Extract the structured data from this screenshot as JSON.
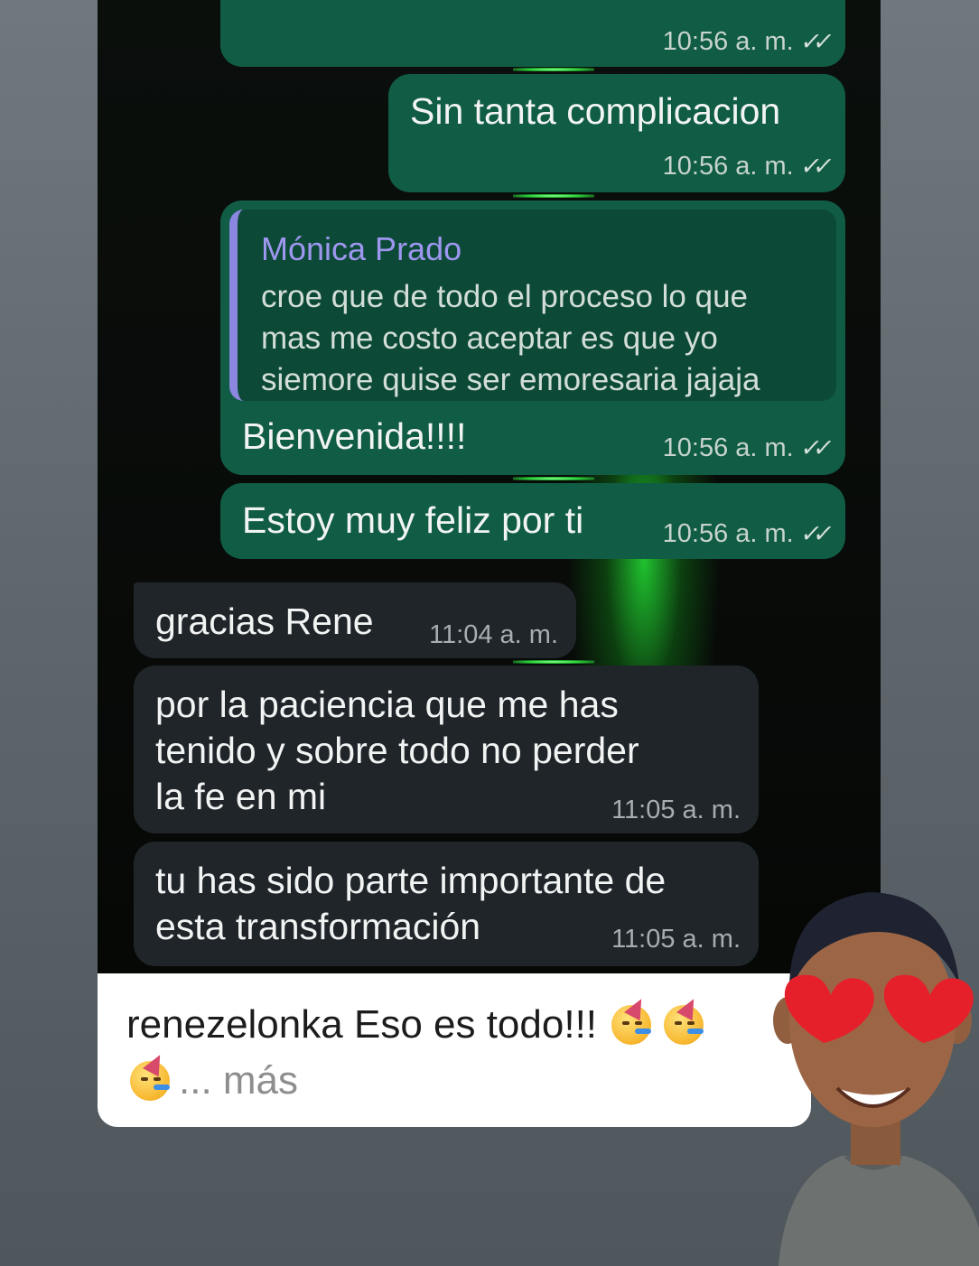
{
  "messages": {
    "m0": {
      "time": "10:56 a. m."
    },
    "m1": {
      "text": "Sin tanta complicacion",
      "time": "10:56 a. m."
    },
    "m2": {
      "quote_author": "Mónica Prado",
      "quote_lines": [
        "croe que de todo el proceso lo que",
        "mas me costo aceptar es que yo",
        "siemore quise ser emoresaria jajaja"
      ],
      "text": "Bienvenida!!!!",
      "time": "10:56 a. m."
    },
    "m3": {
      "text": "Estoy muy feliz por ti",
      "time": "10:56 a. m."
    },
    "m4": {
      "text": "gracias Rene",
      "time": "11:04 a. m."
    },
    "m5": {
      "lines": [
        "por la paciencia que me has",
        "tenido y sobre todo no perder",
        "la fe en mi"
      ],
      "time": "11:05 a. m."
    },
    "m6": {
      "lines": [
        "tu has sido parte importante de",
        "esta transformación"
      ],
      "time": "11:05 a. m."
    }
  },
  "caption": {
    "username": "renezelonka",
    "text": "Eso es todo!!!",
    "more": "... más",
    "emoji_icon": "partying-face-emoji"
  },
  "colors": {
    "outgoing_bubble": "#105c44",
    "incoming_bubble": "#1f2529",
    "quote_accent": "#8b86e0",
    "glow": "#2bd63a"
  }
}
